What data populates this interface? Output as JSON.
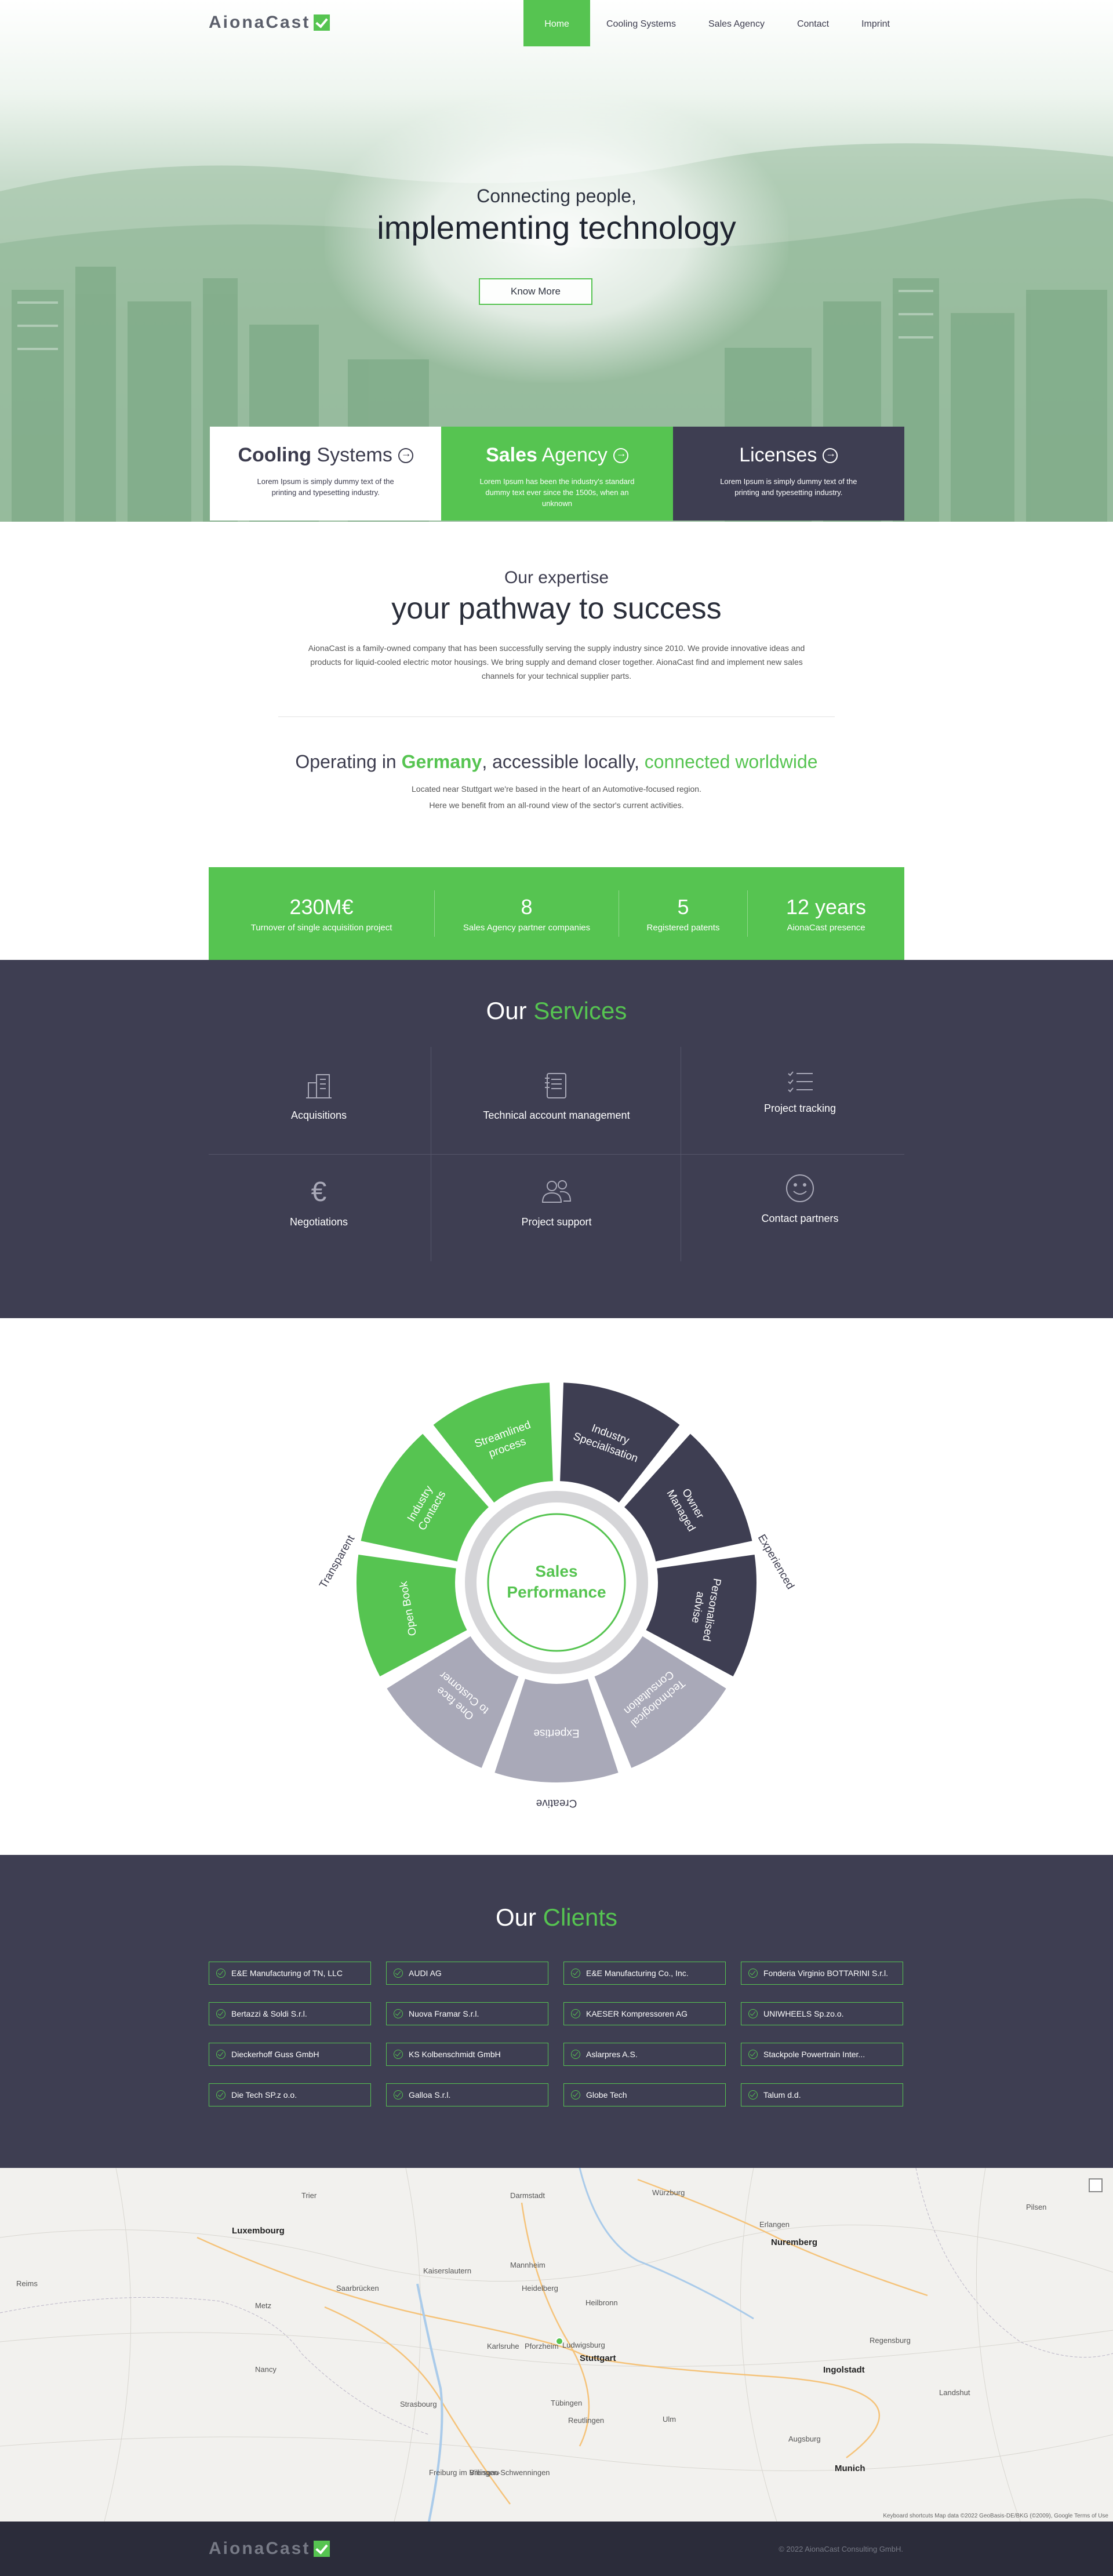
{
  "brand": {
    "name": "AionaCast",
    "accent": "#56c451",
    "dark": "#3e3e52"
  },
  "nav": {
    "items": [
      "Home",
      "Cooling Systems",
      "Sales Agency",
      "Contact",
      "Imprint"
    ],
    "active": "Home"
  },
  "hero": {
    "subtitle": "Connecting people,",
    "title": "implementing technology",
    "button": "Know More"
  },
  "cards": [
    {
      "bold": "Cooling",
      "rest": " Systems",
      "text": "Lorem Ipsum is simply dummy text of the printing and typesetting industry."
    },
    {
      "bold": "Sales",
      "rest": " Agency",
      "text": "Lorem Ipsum has been the industry's standard dummy text ever since the 1500s, when an unknown"
    },
    {
      "bold": "",
      "rest": "Licenses",
      "text": "Lorem Ipsum is simply dummy text of the printing and typesetting industry."
    }
  ],
  "expertise": {
    "sub": "Our expertise",
    "title": "your pathway to success",
    "para": "AionaCast is a family-owned company that has been successfully serving the supply industry since 2010. We provide innovative ideas and products for liquid-cooled electric motor housings. We bring supply and demand closer together. AionaCast find and implement new sales channels for your technical supplier parts."
  },
  "operating": {
    "p1": "Operating in ",
    "country": "Germany",
    "p2": ", accessible locally, ",
    "p3": "connected worldwide",
    "line1": "Located near Stuttgart we're based in the heart of an Automotive-focused region.",
    "line2": "Here we benefit from an all-round view of the sector's current activities."
  },
  "stats": [
    {
      "value": "230M€",
      "label": "Turnover of single acquisition project"
    },
    {
      "value": "8",
      "label": "Sales Agency partner companies"
    },
    {
      "value": "5",
      "label": "Registered patents"
    },
    {
      "value": "12 years",
      "label": "AionaCast presence"
    }
  ],
  "services": {
    "title1": "Our ",
    "title2": "Services",
    "items": [
      {
        "label": "Acquisitions",
        "icon": "building-icon"
      },
      {
        "label": "Technical account management",
        "icon": "document-icon"
      },
      {
        "label": "Project tracking",
        "icon": "checklist-icon"
      },
      {
        "label": "Negotiations",
        "icon": "euro-icon"
      },
      {
        "label": "Project support",
        "icon": "people-icon"
      },
      {
        "label": "Contact partners",
        "icon": "smiley-icon"
      }
    ]
  },
  "wheel": {
    "center1": "Sales",
    "center2": "Performance",
    "segments": [
      {
        "label": "Industry Specialisation",
        "color": "dark"
      },
      {
        "label": "Owner Managed",
        "color": "dark"
      },
      {
        "label": "Personalised advise",
        "color": "dark"
      },
      {
        "label": "Technological Consultation",
        "color": "grey"
      },
      {
        "label": "Expertise",
        "color": "grey"
      },
      {
        "label": "One face to Customer",
        "color": "grey"
      },
      {
        "label": "Open Book",
        "color": "green"
      },
      {
        "label": "Industry Contacts",
        "color": "green"
      },
      {
        "label": "Streamlined process",
        "color": "green"
      }
    ],
    "outer": [
      "Experienced",
      "Creative",
      "Transparent"
    ]
  },
  "clients": {
    "title1": "Our ",
    "title2": "Clients",
    "items": [
      "E&E Manufacturing of TN, LLC",
      "AUDI AG",
      "E&E Manufacturing Co., Inc.",
      "Fonderia Virginio BOTTARINI S.r.l.",
      "Bertazzi & Soldi S.r.l.",
      "Nuova Framar S.r.l.",
      "KAESER Kompressoren AG",
      "UNIWHEELS Sp.zo.o.",
      "Dieckerhoff Guss GmbH",
      "KS Kolbenschmidt GmbH",
      "Aslarpres A.S.",
      "Stackpole Powertrain Inter...",
      "Die Tech SP.z o.o.",
      "Galloa S.r.l.",
      "Globe Tech",
      "Talum d.d."
    ]
  },
  "map": {
    "cities": [
      "Luxembourg",
      "Saarbrücken",
      "Mannheim",
      "Heidelberg",
      "Kaiserslautern",
      "Karlsruhe",
      "Stuttgart",
      "Pforzheim",
      "Ludwigsburg",
      "Nuremberg",
      "Erlangen",
      "Würzburg",
      "Darmstadt",
      "Ingolstadt",
      "Regensburg",
      "Augsburg",
      "Munich",
      "Strasbourg",
      "Metz",
      "Nancy",
      "Reims",
      "Heilbronn",
      "Tübingen",
      "Reutlingen",
      "Ulm",
      "Freiburg im Breisgau",
      "Villingen-Schwenningen",
      "Trier",
      "Landshut",
      "Pilsen"
    ],
    "credit": "Keyboard shortcuts  Map data ©2022 GeoBasis-DE/BKG (©2009), Google  Terms of Use"
  },
  "footer": {
    "copy": "© 2022 AionaCast Consulting GmbH."
  }
}
